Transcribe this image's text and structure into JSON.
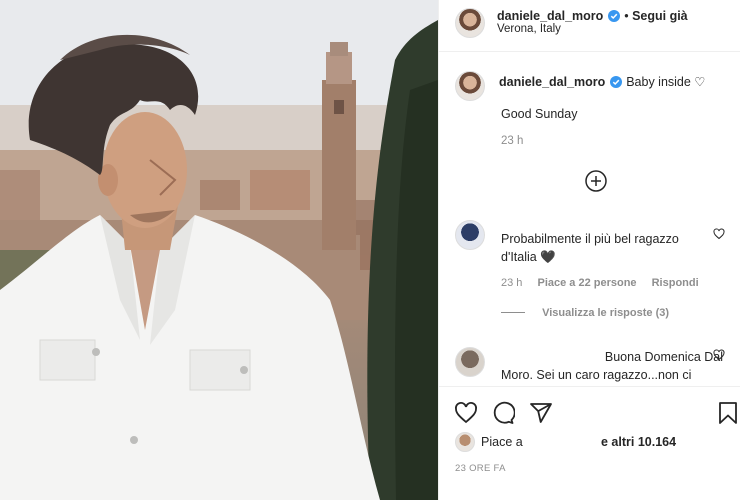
{
  "post": {
    "username": "daniele_dal_moro",
    "follow_label": "Segui già",
    "location": "Verona, Italy"
  },
  "caption": {
    "username": "daniele_dal_moro",
    "text_line1": "Baby inside ♡",
    "text_line2": "Good Sunday",
    "time": "23 h"
  },
  "comments": [
    {
      "text_line1": "Probabilmente il più bel ragazzo",
      "text_line2": "d'Italia 🖤",
      "time": "23 h",
      "likes": "Piace a 22 persone",
      "reply_label": "Rispondi",
      "view_replies": "Visualizza le risposte (3)"
    },
    {
      "text_line1": "Buona Domenica Dal",
      "text_line2": "Moro. Sei un caro ragazzo...non ci"
    }
  ],
  "likes_bar": {
    "prefix": "Piace a",
    "suffix": "e altri 10.164",
    "timestamp": "23 ORE FA"
  },
  "icons": {
    "verified": "verified-badge-icon",
    "like": "heart-icon",
    "comment": "comment-icon",
    "share": "paper-plane-icon",
    "save": "bookmark-icon",
    "load_more": "plus-circle-icon"
  },
  "colors": {
    "verified_blue": "#3897f0",
    "text": "#262626",
    "muted": "#8e8e8e"
  }
}
